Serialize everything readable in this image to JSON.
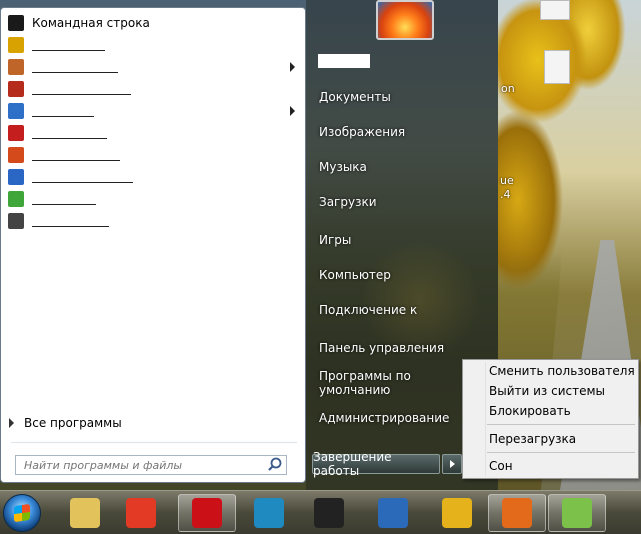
{
  "start_menu": {
    "programs": [
      {
        "label": "Командная строка",
        "icon": "command-prompt-icon",
        "color": "#1a1a1a",
        "submenu": false,
        "redacted": false
      },
      {
        "label": "",
        "icon": "app-icon",
        "color": "#d8a200",
        "submenu": false,
        "redacted": true
      },
      {
        "label": "",
        "icon": "app-icon",
        "color": "#c0652a",
        "submenu": true,
        "redacted": true
      },
      {
        "label": "",
        "icon": "filezilla-icon",
        "color": "#b52b1c",
        "submenu": false,
        "redacted": true
      },
      {
        "label": "",
        "icon": "app-icon",
        "color": "#2e6fc7",
        "submenu": true,
        "redacted": true
      },
      {
        "label": "",
        "icon": "aida64-icon",
        "color": "#c41e1e",
        "submenu": false,
        "redacted": true
      },
      {
        "label": "",
        "icon": "app-icon",
        "color": "#d44a1a",
        "submenu": false,
        "redacted": true
      },
      {
        "label": "",
        "icon": "network-icon",
        "color": "#2a66c4",
        "submenu": false,
        "redacted": true
      },
      {
        "label": "",
        "icon": "wifi-icon",
        "color": "#3fa63a",
        "submenu": false,
        "redacted": true
      },
      {
        "label": "",
        "icon": "app-icon",
        "color": "#444444",
        "submenu": false,
        "redacted": true
      }
    ],
    "all_programs": "Все программы",
    "search_placeholder": "Найти программы и файлы",
    "right_items": [
      "Документы",
      "Изображения",
      "Музыка",
      "Загрузки",
      "Игры",
      "Компьютер",
      "Подключение к",
      "Панель управления",
      "Программы по умолчанию",
      "Администрирование"
    ],
    "shutdown_label": "Завершение работы"
  },
  "shutdown_menu": {
    "items": [
      "Сменить пользователя",
      "Выйти из системы",
      "Блокировать",
      "Перезагрузка",
      "Сон"
    ]
  },
  "desktop": {
    "labels": [
      "on",
      "ue",
      ".4"
    ]
  },
  "taskbar": {
    "buttons": [
      {
        "icon": "folder-icon",
        "color": "#e2c25a",
        "active": false
      },
      {
        "icon": "media-player-icon",
        "color": "#e23a24",
        "active": false
      },
      {
        "icon": "opera-icon",
        "color": "#cc1018",
        "active": true
      },
      {
        "icon": "tablet-app-icon",
        "color": "#1f8ac0",
        "active": false
      },
      {
        "icon": "camera-icon",
        "color": "#222222",
        "active": false
      },
      {
        "icon": "globe-icon",
        "color": "#2a6ab8",
        "active": false
      },
      {
        "icon": "chrome-icon",
        "color": "#e5b21c",
        "active": false
      },
      {
        "icon": "firefox-icon",
        "color": "#e36a1a",
        "active": true
      },
      {
        "icon": "meter-icon",
        "color": "#7cc24a",
        "active": true
      }
    ]
  }
}
